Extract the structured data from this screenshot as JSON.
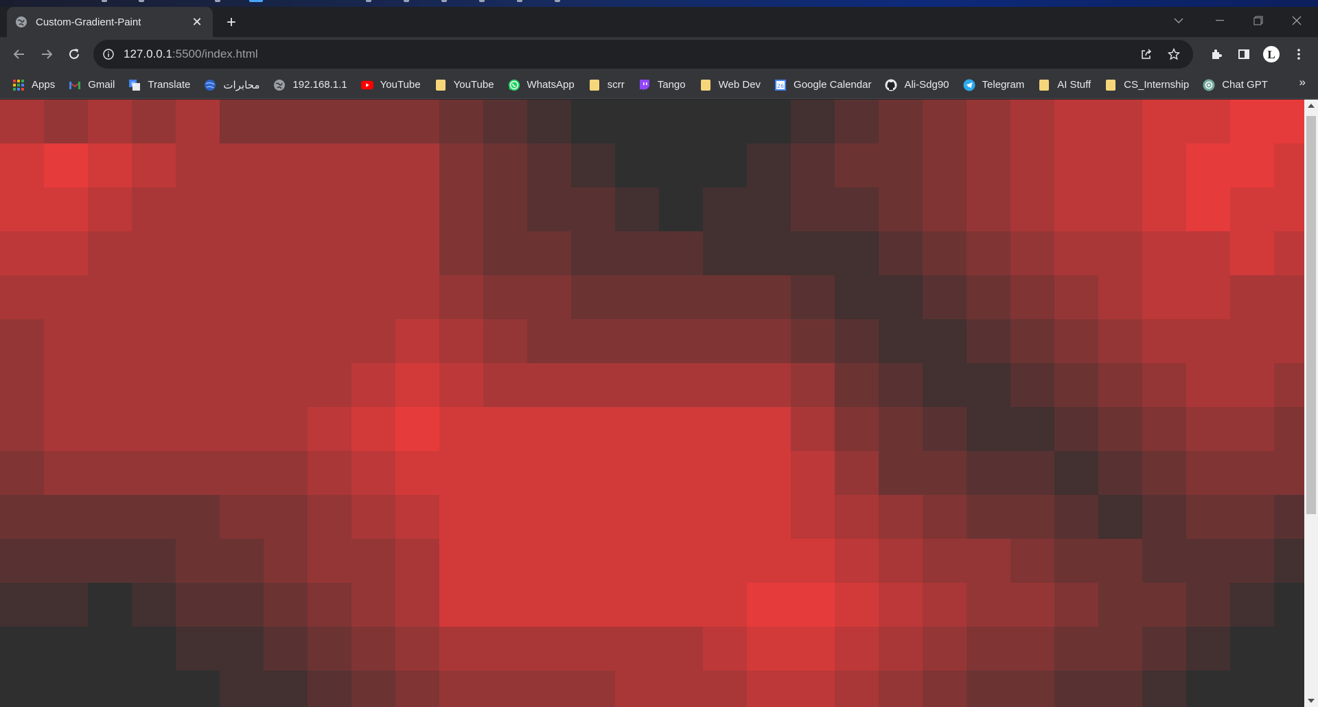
{
  "browser": {
    "tab_title": "Custom-Gradient-Paint",
    "tab_close": "✕",
    "new_tab": "+",
    "url_host": "127.0.0.1",
    "url_rest": ":5500/index.html",
    "bookmarks": [
      {
        "label": "Apps",
        "icon": "apps-grid-icon"
      },
      {
        "label": "Gmail",
        "icon": "gmail-icon"
      },
      {
        "label": "Translate",
        "icon": "translate-icon"
      },
      {
        "label": "محابرات",
        "icon": "globe-blue-icon"
      },
      {
        "label": "192.168.1.1",
        "icon": "globe-icon"
      },
      {
        "label": "YouTube",
        "icon": "youtube-icon"
      },
      {
        "label": "YouTube",
        "icon": "folder-icon"
      },
      {
        "label": "WhatsApp",
        "icon": "whatsapp-icon"
      },
      {
        "label": "scrr",
        "icon": "folder-icon"
      },
      {
        "label": "Tango",
        "icon": "twitch-icon"
      },
      {
        "label": "Web Dev",
        "icon": "folder-icon"
      },
      {
        "label": "Google Calendar",
        "icon": "calendar-icon"
      },
      {
        "label": "Ali-Sdg90",
        "icon": "github-icon"
      },
      {
        "label": "Telegram",
        "icon": "telegram-icon"
      },
      {
        "label": "AI Stuff",
        "icon": "folder-icon"
      },
      {
        "label": "CS_Internship",
        "icon": "folder-icon"
      },
      {
        "label": "Chat GPT",
        "icon": "chatgpt-icon"
      }
    ],
    "bookmarks_overflow": "»"
  },
  "colors": {
    "red_bright": "#e63b3b",
    "red_dark": "#2f2f2f"
  },
  "canvas": {
    "cols": 30,
    "rows": 14,
    "intensity_grid": [
      [
        6,
        5,
        6,
        5,
        6,
        4,
        4,
        4,
        4,
        4,
        3,
        2,
        1,
        0,
        0,
        0,
        0,
        0,
        1,
        2,
        3,
        4,
        5,
        6,
        7,
        7,
        8,
        8,
        9,
        9
      ],
      [
        8,
        9,
        8,
        7,
        6,
        6,
        6,
        6,
        6,
        6,
        4,
        3,
        2,
        1,
        0,
        0,
        0,
        1,
        2,
        3,
        3,
        4,
        5,
        6,
        7,
        7,
        8,
        9,
        9,
        8
      ],
      [
        8,
        8,
        7,
        6,
        6,
        6,
        6,
        6,
        6,
        6,
        4,
        3,
        2,
        2,
        1,
        0,
        1,
        1,
        2,
        2,
        3,
        4,
        5,
        6,
        7,
        7,
        8,
        9,
        8,
        8
      ],
      [
        7,
        7,
        6,
        6,
        6,
        6,
        6,
        6,
        6,
        6,
        4,
        3,
        3,
        2,
        2,
        2,
        1,
        1,
        1,
        1,
        2,
        3,
        4,
        5,
        6,
        6,
        7,
        7,
        8,
        7
      ],
      [
        6,
        6,
        6,
        6,
        6,
        6,
        6,
        6,
        6,
        6,
        5,
        4,
        4,
        3,
        3,
        3,
        3,
        3,
        2,
        1,
        1,
        2,
        3,
        4,
        5,
        6,
        7,
        7,
        6,
        6
      ],
      [
        5,
        6,
        6,
        6,
        6,
        6,
        6,
        6,
        6,
        7,
        6,
        5,
        4,
        4,
        4,
        4,
        4,
        4,
        3,
        2,
        1,
        1,
        2,
        3,
        4,
        5,
        6,
        6,
        6,
        6
      ],
      [
        5,
        6,
        6,
        6,
        6,
        6,
        6,
        6,
        7,
        8,
        7,
        6,
        6,
        6,
        6,
        6,
        6,
        6,
        5,
        3,
        2,
        1,
        1,
        2,
        3,
        4,
        5,
        6,
        6,
        5
      ],
      [
        5,
        6,
        6,
        6,
        6,
        6,
        6,
        7,
        8,
        9,
        8,
        8,
        8,
        8,
        8,
        8,
        8,
        8,
        6,
        4,
        3,
        2,
        1,
        1,
        2,
        3,
        4,
        5,
        5,
        4
      ],
      [
        4,
        5,
        5,
        5,
        5,
        5,
        5,
        6,
        7,
        8,
        8,
        8,
        8,
        8,
        8,
        8,
        8,
        8,
        7,
        5,
        3,
        3,
        2,
        2,
        1,
        2,
        3,
        4,
        4,
        4
      ],
      [
        3,
        3,
        3,
        3,
        3,
        4,
        4,
        5,
        6,
        7,
        8,
        8,
        8,
        8,
        8,
        8,
        8,
        8,
        7,
        6,
        5,
        4,
        3,
        3,
        2,
        1,
        2,
        3,
        3,
        2
      ],
      [
        2,
        2,
        2,
        2,
        3,
        3,
        4,
        5,
        5,
        6,
        8,
        8,
        8,
        8,
        8,
        8,
        8,
        8,
        8,
        7,
        6,
        5,
        5,
        4,
        3,
        3,
        2,
        2,
        2,
        1
      ],
      [
        1,
        1,
        0,
        1,
        2,
        2,
        3,
        4,
        5,
        6,
        8,
        8,
        8,
        8,
        8,
        8,
        8,
        9,
        9,
        8,
        7,
        6,
        5,
        5,
        4,
        3,
        3,
        2,
        1,
        0
      ],
      [
        0,
        0,
        0,
        0,
        1,
        1,
        2,
        3,
        4,
        5,
        6,
        6,
        6,
        6,
        6,
        6,
        7,
        8,
        8,
        7,
        6,
        5,
        4,
        4,
        3,
        3,
        2,
        1,
        0,
        0
      ],
      [
        0,
        0,
        0,
        0,
        0,
        1,
        1,
        2,
        3,
        4,
        5,
        5,
        5,
        5,
        6,
        6,
        6,
        7,
        7,
        6,
        5,
        4,
        3,
        3,
        2,
        2,
        1,
        0,
        0,
        0
      ]
    ]
  }
}
